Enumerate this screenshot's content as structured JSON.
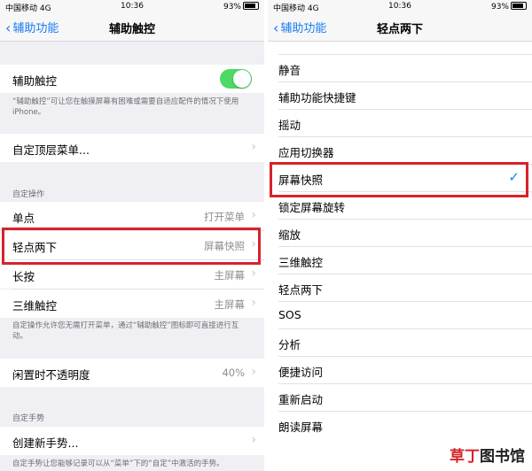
{
  "left": {
    "status": {
      "carrier": "中国移动  4G",
      "time": "10:36",
      "battery": "93%"
    },
    "nav": {
      "back": "辅助功能",
      "title": "辅助触控"
    },
    "toggle_row": {
      "label": "辅助触控",
      "on": true
    },
    "toggle_note": "“辅助触控”可让您在触摸屏幕有困难或需要自适应配件的情况下使用 iPhone。",
    "top_menu": {
      "label": "自定顶层菜单..."
    },
    "custom_actions_header": "自定操作",
    "actions": [
      {
        "label": "单点",
        "value": "打开菜单"
      },
      {
        "label": "轻点两下",
        "value": "屏幕快照"
      },
      {
        "label": "长按",
        "value": "主屏幕"
      },
      {
        "label": "三维触控",
        "value": "主屏幕"
      }
    ],
    "actions_note": "自定操作允许您无需打开菜单，通过“辅助触控”图标即可直接进行互动。",
    "idle_opacity": {
      "label": "闲置时不透明度",
      "value": "40%"
    },
    "gestures_header": "自定手势",
    "new_gesture": {
      "label": "创建新手势..."
    },
    "gestures_note": "自定手势让您能够记录可以从“菜单”下的“自定”中激活的手势。"
  },
  "right": {
    "status": {
      "carrier": "中国移动  4G",
      "time": "10:36",
      "battery": "93%"
    },
    "nav": {
      "back": "辅助功能",
      "title": "轻点两下"
    },
    "items": [
      {
        "label": "静音"
      },
      {
        "label": "辅助功能快捷键"
      },
      {
        "label": "摇动"
      },
      {
        "label": "应用切换器"
      },
      {
        "label": "屏幕快照",
        "checked": true
      },
      {
        "label": "锁定屏幕旋转"
      },
      {
        "label": "缩放"
      },
      {
        "label": "三维触控"
      },
      {
        "label": "轻点两下"
      },
      {
        "label": "SOS"
      },
      {
        "label": "分析"
      },
      {
        "label": "便捷访问"
      },
      {
        "label": "重新启动"
      },
      {
        "label": "朗读屏幕"
      }
    ]
  },
  "watermark": {
    "part1": "草丁",
    "part2": "图书馆"
  },
  "colors": {
    "accent": "#1a7cf2",
    "toggle_on": "#4cd964",
    "highlight": "#d6232a"
  },
  "icons": [
    "chevron-left-icon",
    "chevron-right-icon",
    "checkmark-icon",
    "battery-icon"
  ]
}
